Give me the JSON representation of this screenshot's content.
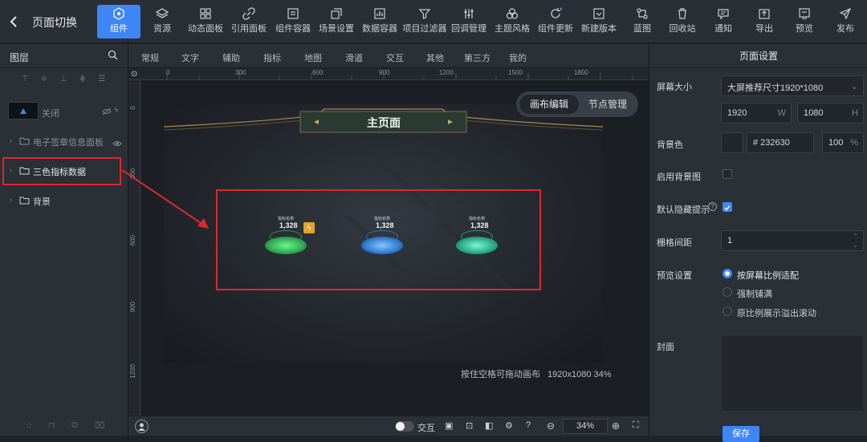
{
  "header": {
    "back_icon": "chevron-left-icon",
    "page_switch": "页面切换",
    "tools": [
      {
        "label": "组件",
        "icon": "component-icon",
        "active": true
      },
      {
        "label": "资源",
        "icon": "layers-icon"
      },
      {
        "label": "动态面板",
        "icon": "grid-panel-icon"
      },
      {
        "label": "引用面板",
        "icon": "link-icon"
      },
      {
        "label": "组件容器",
        "icon": "container-icon"
      },
      {
        "label": "场景设置",
        "icon": "scene-icon"
      },
      {
        "label": "数据容器",
        "icon": "chart-box-icon"
      },
      {
        "label": "项目过滤器",
        "icon": "filter-icon"
      },
      {
        "label": "回调管理",
        "icon": "sliders-icon"
      },
      {
        "label": "主题风格",
        "icon": "theme-icon"
      },
      {
        "label": "组件更新",
        "icon": "refresh-icon"
      },
      {
        "label": "新建版本",
        "icon": "new-version-icon"
      },
      {
        "label": "蓝图",
        "icon": "blueprint-icon"
      },
      {
        "label": "回收站",
        "icon": "trash-icon"
      },
      {
        "label": "通知",
        "icon": "message-icon"
      },
      {
        "label": "导出",
        "icon": "export-icon"
      },
      {
        "label": "预览",
        "icon": "preview-icon"
      },
      {
        "label": "发布",
        "icon": "send-icon"
      }
    ]
  },
  "left_panel": {
    "title": "图层",
    "layers": [
      {
        "name": "关闭",
        "type": "thumbnail"
      },
      {
        "name": "电子签章信息面板",
        "type": "folder"
      },
      {
        "name": "三色指标数据",
        "type": "folder",
        "highlighted": true
      },
      {
        "name": "背景",
        "type": "folder"
      }
    ]
  },
  "categories": [
    "常规",
    "文字",
    "辅助",
    "指标",
    "地图",
    "滑道",
    "交互",
    "其他",
    "第三方",
    "我的"
  ],
  "rulers": {
    "h": [
      "0",
      "300",
      "600",
      "900",
      "1200",
      "1500",
      "1800"
    ],
    "v": [
      "0",
      "300",
      "600",
      "900",
      "1200"
    ]
  },
  "canvas": {
    "mode_canvas": "画布编辑",
    "mode_node": "节点管理",
    "screen_title": "主页面",
    "indicators": [
      {
        "label": "指标名称",
        "value": "1,328",
        "color": "#3dd36a"
      },
      {
        "label": "指标名称",
        "value": "1,328",
        "color": "#3c9cf0"
      },
      {
        "label": "指标名称",
        "value": "1,328",
        "color": "#34d6b0"
      }
    ],
    "hint": "按住空格可拖动画布",
    "size_info": "1920x1080 34%"
  },
  "bottom_bar": {
    "interact_label": "交互",
    "zoom": "34%"
  },
  "right_panel": {
    "title": "页面设置",
    "screen_size_label": "屏幕大小",
    "screen_size_value": "大屏推荐尺寸1920*1080",
    "width": "1920",
    "width_unit": "W",
    "height": "1080",
    "height_unit": "H",
    "bg_color_label": "背景色",
    "bg_color_value": "# 232630",
    "bg_opacity": "100",
    "bg_opacity_unit": "%",
    "bg_image_label": "启用背景图",
    "hide_tip_label": "默认隐藏提示",
    "grid_label": "栅格间距",
    "grid_value": "1",
    "preview_label": "预览设置",
    "preview_options": [
      "按屏幕比例适配",
      "强制铺满",
      "原比例展示溢出滚动"
    ],
    "cover_label": "封面",
    "save_button": "保存"
  },
  "colors": {
    "accent": "#3d86f5",
    "highlight": "#e0282a"
  }
}
